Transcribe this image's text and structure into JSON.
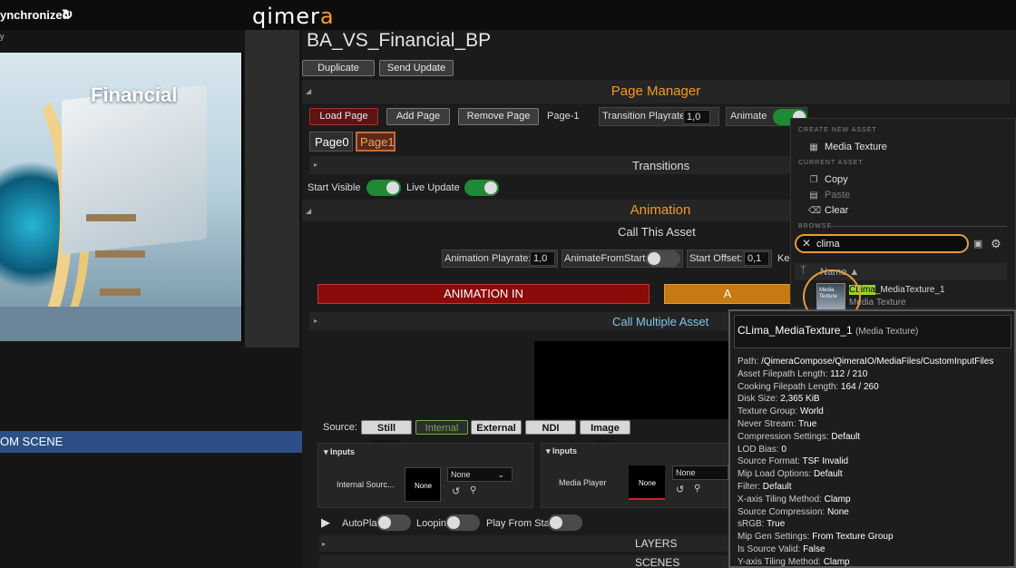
{
  "topbar": {
    "sync_label": "ynchronized",
    "sync_icon": "refresh-icon",
    "logo_a": "qimer",
    "logo_b": "a"
  },
  "preview": {
    "headline": "Financial",
    "strip_label": "y"
  },
  "scene": {
    "label": "OM SCENE"
  },
  "asset": {
    "title": "BA_VS_Financial_BP",
    "duplicate": "Duplicate",
    "send_update": "Send Update"
  },
  "page_manager": {
    "title": "Page Manager",
    "load_page": "Load Page",
    "add_page": "Add Page",
    "remove_page": "Remove Page",
    "current_page": "Page-1",
    "transition_label": "Transition Playrate",
    "transition_value": "1,0",
    "animate_label": "Animate",
    "pages": [
      "Page0",
      "Page1"
    ],
    "transitions": "Transitions",
    "start_visible": "Start Visible",
    "live_update": "Live Update"
  },
  "animation": {
    "title": "Animation",
    "call_this": "Call This Asset",
    "playrate_label": "Animation Playrate:",
    "playrate_value": "1,0",
    "from_start_label": "AnimateFromStart:",
    "offset_label": "Start Offset:",
    "offset_value": "0,1",
    "ke_label": "Ke",
    "anim_in": "ANIMATION IN",
    "anim_out": "A",
    "call_multiple": "Call Multiple Asset"
  },
  "source": {
    "label": "Source:",
    "tabs": [
      "Still Image",
      "Internal",
      "External",
      "NDI",
      "Image Seq"
    ],
    "inputs_left": "Inputs",
    "inputs_right": "Inputs",
    "internal_source": "Internal Sourc...",
    "none": "None",
    "none_select": "None",
    "media_player": "Media Player",
    "none2": "None",
    "none_select2": "None",
    "autoplay": "AutoPla",
    "looping": "Looping",
    "play_from_start": "Play From Star",
    "layers": "LAYERS",
    "scenes": "SCENES"
  },
  "popup": {
    "create_header": "CREATE NEW ASSET",
    "media_texture": "Media Texture",
    "current_header": "CURRENT ASSET",
    "copy": "Copy",
    "paste": "Paste",
    "clear": "Clear",
    "browse_header": "BROWSE",
    "search_value": "clima",
    "col_name": "Name",
    "result_hl": "CLima",
    "result_rest": "_MediaTexture_1",
    "result_type": "Media Texture",
    "thumb_text": "Media Texture"
  },
  "tooltip": {
    "title": "CLima_MediaTexture_1",
    "type": "(Media Texture)",
    "rows": [
      [
        "Path:",
        "/QimeraCompose/QimeraIO/MediaFiles/CustomInputFiles"
      ],
      [
        "Asset Filepath Length:",
        "112 / 210"
      ],
      [
        "Cooking Filepath Length:",
        "164 / 260"
      ],
      [
        "Disk Size:",
        "2,365 KiB"
      ],
      [
        "Texture Group:",
        "World"
      ],
      [
        "Never Stream:",
        "True"
      ],
      [
        "Compression Settings:",
        "Default"
      ],
      [
        "LOD Bias:",
        "0"
      ],
      [
        "Source Format:",
        "TSF Invalid"
      ],
      [
        "Mip Load Options:",
        "Default"
      ],
      [
        "Filter:",
        "Default"
      ],
      [
        "X-axis Tiling Method:",
        "Clamp"
      ],
      [
        "Source Compression:",
        "None"
      ],
      [
        "sRGB:",
        "True"
      ],
      [
        "Mip Gen Settings:",
        "From Texture Group"
      ],
      [
        "Is Source Valid:",
        "False"
      ],
      [
        "Y-axis Tiling Method:",
        "Clamp"
      ]
    ]
  },
  "colors": {
    "accent": "#f09a2a",
    "toggle_on": "#1f8a35",
    "anim_in": "#8b0a0a",
    "anim_out": "#c77a12",
    "highlight": "#e99a3c"
  }
}
